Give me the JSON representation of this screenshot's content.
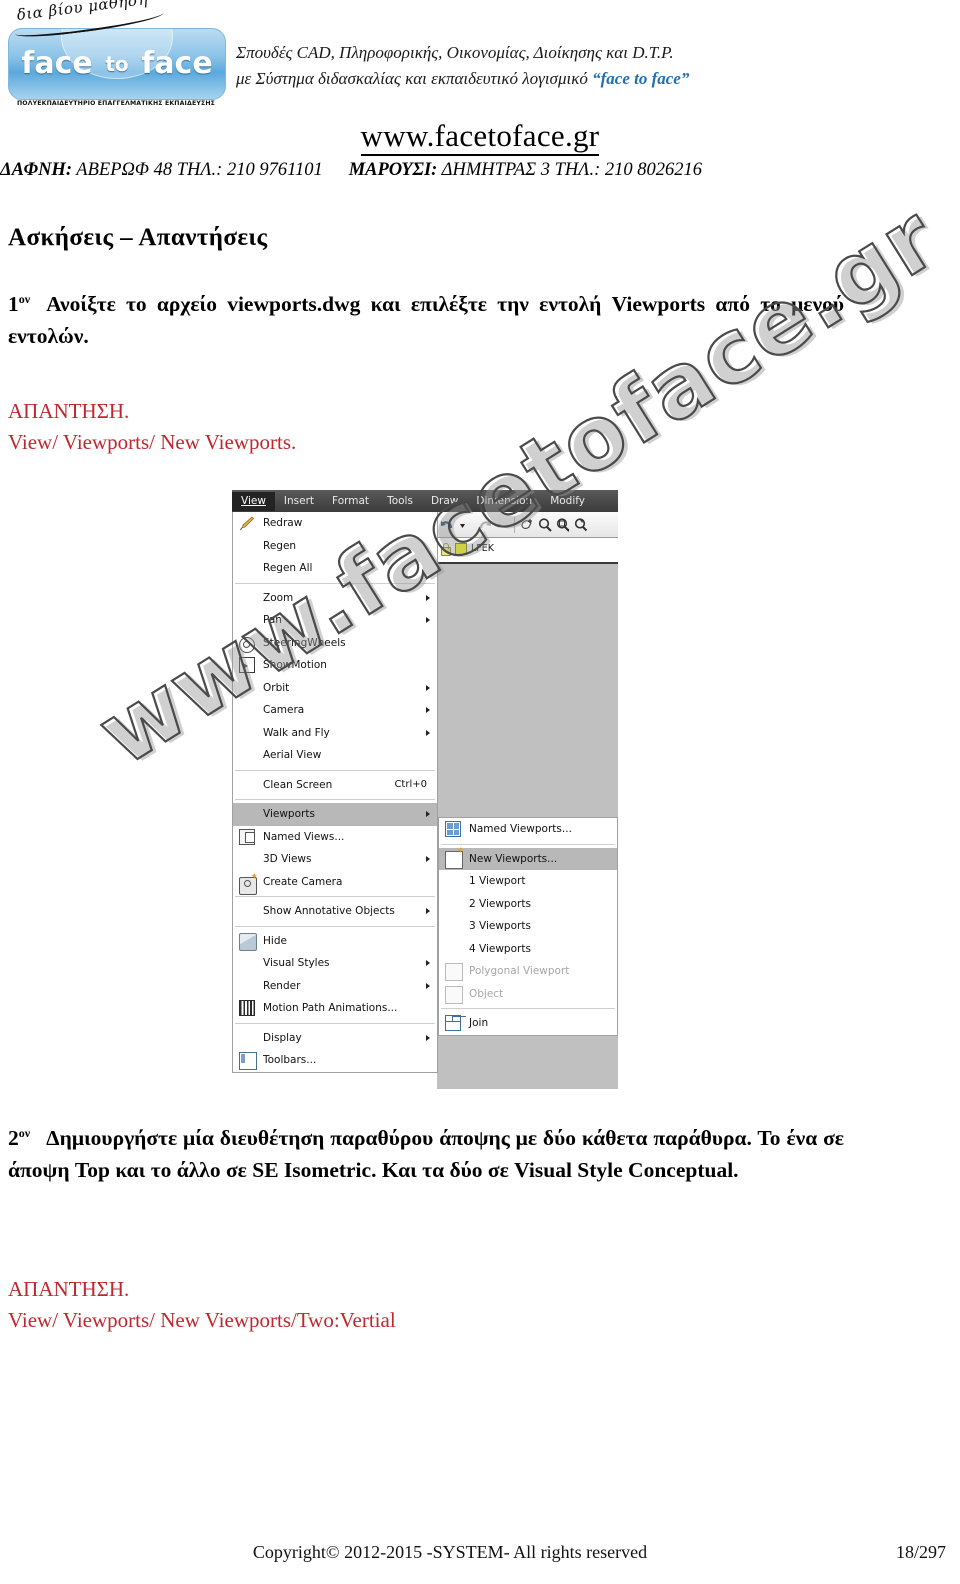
{
  "header": {
    "logo": {
      "script_text": "δια βίου μάθηση",
      "word1": "face",
      "word2": "to",
      "word3": "face",
      "caption": "ΠΟΛΥΕΚΠΑΙΔΕΥΤΗΡΙΟ ΕΠΑΓΓΕΛΜΑΤΙΚΗΣ ΕΚΠΑΙΔΕΥΣΗΣ"
    },
    "line1": "Σπουδές CAD, Πληροφορικής, Οικονομίας, Διοίκησης και D.T.P.",
    "line2_prefix": "με Σύστημα διδασκαλίας και εκπαιδευτικό λογισμικό ",
    "line2_brand": "“face to face”",
    "website": "www.facetoface.gr",
    "address_left_label": "ΔΑΦΝΗ:",
    "address_left": " ΑΒΕΡΩΦ 48 ΤΗΛ.: 210 9761101",
    "address_right_label": "ΜΑΡΟΥΣΙ:",
    "address_right": " ΔΗΜΗΤΡΑΣ 3 ΤΗΛ.: 210 8026216"
  },
  "body": {
    "section_heading": "Ασκήσεις – Απαντήσεις",
    "q1": {
      "number": "1",
      "number_sup": "ον",
      "text": "Ανοίξτε το αρχείο viewports.dwg και επιλέξτε την εντολή Viewports από  το μενού εντολών."
    },
    "a1": {
      "label": "ΑΠΑΝΤΗΣΗ.",
      "path": "View/ Viewports/ New Viewports."
    },
    "q2": {
      "number": "2",
      "number_sup": "ον",
      "text": "Δημιουργήστε μία διευθέτηση παραθύρου άποψης με δύο κάθετα παράθυρα. Το ένα σε άποψη Top και το άλλο σε SE Isometric. Και τα δύο σε Visual Style Conceptual."
    },
    "a2": {
      "label": "ΑΠΑΝΤΗΣΗ.",
      "path": "View/ Viewports/ New Viewports/Two:Vertial"
    }
  },
  "watermark": {
    "text": "www.facetoface.gr"
  },
  "screenshot": {
    "menubar": [
      {
        "label": "View",
        "mnemonic": "V",
        "active": true
      },
      {
        "label": "Insert",
        "mnemonic": "I",
        "active": false
      },
      {
        "label": "Format",
        "mnemonic": "o",
        "active": false
      },
      {
        "label": "Tools",
        "mnemonic": "T",
        "active": false
      },
      {
        "label": "Draw",
        "mnemonic": "D",
        "active": false
      },
      {
        "label": "Dimension",
        "mnemonic": "n",
        "active": false
      },
      {
        "label": "Modify",
        "mnemonic": "M",
        "active": false
      }
    ],
    "layer": {
      "name": "LFEK",
      "color": "#ffff00"
    },
    "view_menu": [
      {
        "label": "Redraw",
        "icon": "pencil-icon",
        "type": "item",
        "shortcut": "",
        "arrow": false,
        "disabled": false,
        "selected": false
      },
      {
        "label": "Regen",
        "icon": "",
        "type": "item",
        "shortcut": "",
        "arrow": false,
        "disabled": false,
        "selected": false
      },
      {
        "label": "Regen All",
        "icon": "",
        "type": "item",
        "shortcut": "",
        "arrow": false,
        "disabled": false,
        "selected": false
      },
      {
        "type": "separator"
      },
      {
        "label": "Zoom",
        "icon": "",
        "type": "item",
        "shortcut": "",
        "arrow": true,
        "disabled": false,
        "selected": false
      },
      {
        "label": "Pan",
        "icon": "",
        "type": "item",
        "shortcut": "",
        "arrow": true,
        "disabled": false,
        "selected": false
      },
      {
        "label": "SteeringWheels",
        "icon": "steering-wheel-icon",
        "type": "item",
        "shortcut": "",
        "arrow": false,
        "disabled": false,
        "selected": false
      },
      {
        "label": "ShowMotion",
        "icon": "show-motion-icon",
        "type": "item",
        "shortcut": "",
        "arrow": false,
        "disabled": false,
        "selected": false
      },
      {
        "label": "Orbit",
        "icon": "",
        "type": "item",
        "shortcut": "",
        "arrow": true,
        "disabled": false,
        "selected": false
      },
      {
        "label": "Camera",
        "icon": "",
        "type": "item",
        "shortcut": "",
        "arrow": true,
        "disabled": false,
        "selected": false
      },
      {
        "label": "Walk and Fly",
        "icon": "",
        "type": "item",
        "shortcut": "",
        "arrow": true,
        "disabled": false,
        "selected": false
      },
      {
        "label": "Aerial View",
        "icon": "",
        "type": "item",
        "shortcut": "",
        "arrow": false,
        "disabled": false,
        "selected": false
      },
      {
        "type": "separator"
      },
      {
        "label": "Clean Screen",
        "icon": "",
        "type": "item",
        "shortcut": "Ctrl+0",
        "arrow": false,
        "disabled": false,
        "selected": false
      },
      {
        "type": "separator"
      },
      {
        "label": "Viewports",
        "icon": "",
        "type": "item",
        "shortcut": "",
        "arrow": true,
        "disabled": false,
        "selected": true
      },
      {
        "label": "Named Views...",
        "icon": "named-views-icon",
        "type": "item",
        "shortcut": "",
        "arrow": false,
        "disabled": false,
        "selected": false
      },
      {
        "label": "3D Views",
        "icon": "",
        "type": "item",
        "shortcut": "",
        "arrow": true,
        "disabled": false,
        "selected": false
      },
      {
        "label": "Create Camera",
        "icon": "create-camera-icon",
        "type": "item",
        "shortcut": "",
        "arrow": false,
        "disabled": false,
        "selected": false
      },
      {
        "type": "separator"
      },
      {
        "label": "Show Annotative Objects",
        "icon": "",
        "type": "item",
        "shortcut": "",
        "arrow": true,
        "disabled": false,
        "selected": false
      },
      {
        "type": "separator"
      },
      {
        "label": "Hide",
        "icon": "hide-icon",
        "type": "item",
        "shortcut": "",
        "arrow": false,
        "disabled": false,
        "selected": false
      },
      {
        "label": "Visual Styles",
        "icon": "",
        "type": "item",
        "shortcut": "",
        "arrow": true,
        "disabled": false,
        "selected": false
      },
      {
        "label": "Render",
        "icon": "",
        "type": "item",
        "shortcut": "",
        "arrow": true,
        "disabled": false,
        "selected": false
      },
      {
        "label": "Motion Path Animations...",
        "icon": "motion-path-icon",
        "type": "item",
        "shortcut": "",
        "arrow": false,
        "disabled": false,
        "selected": false
      },
      {
        "type": "separator"
      },
      {
        "label": "Display",
        "icon": "",
        "type": "item",
        "shortcut": "",
        "arrow": true,
        "disabled": false,
        "selected": false
      },
      {
        "label": "Toolbars...",
        "icon": "toolbars-icon",
        "type": "item",
        "shortcut": "",
        "arrow": false,
        "disabled": false,
        "selected": false
      }
    ],
    "viewports_submenu": [
      {
        "label": "Named Viewports...",
        "icon": "named-viewports-icon",
        "type": "item",
        "disabled": false,
        "selected": false
      },
      {
        "type": "separator"
      },
      {
        "label": "New Viewports...",
        "icon": "new-viewports-icon",
        "type": "item",
        "disabled": false,
        "selected": true
      },
      {
        "label": "1 Viewport",
        "icon": "",
        "type": "item",
        "disabled": false,
        "selected": false
      },
      {
        "label": "2 Viewports",
        "icon": "",
        "type": "item",
        "disabled": false,
        "selected": false
      },
      {
        "label": "3 Viewports",
        "icon": "",
        "type": "item",
        "disabled": false,
        "selected": false
      },
      {
        "label": "4 Viewports",
        "icon": "",
        "type": "item",
        "disabled": false,
        "selected": false
      },
      {
        "label": "Polygonal Viewport",
        "icon": "polygonal-viewport-icon",
        "type": "item",
        "disabled": true,
        "selected": false
      },
      {
        "label": "Object",
        "icon": "object-icon",
        "type": "item",
        "disabled": true,
        "selected": false
      },
      {
        "type": "separator"
      },
      {
        "label": "Join",
        "icon": "join-icon",
        "type": "item",
        "disabled": false,
        "selected": false
      }
    ]
  },
  "footer": {
    "copyright": "Copyright© 2012-2015 -SYSTEM- All rights reserved",
    "page": "18/297"
  }
}
